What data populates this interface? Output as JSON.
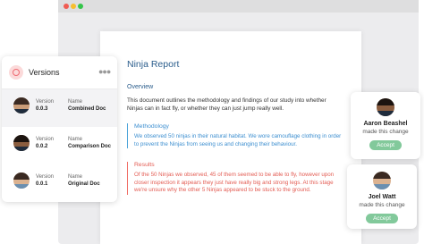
{
  "document": {
    "title": "Ninja Report",
    "overview": {
      "heading": "Overview",
      "text": "This document outlines the methodology and findings of our study into whether Ninjas can in fact fly, or whether they can just jump really well."
    },
    "methodology": {
      "heading": "Methodology",
      "text": "We observed 50 ninjas in their natural habitat. We wore camouflage clothing in order to prevent the Ninjas from seeing us and changing their behaviour."
    },
    "results": {
      "heading": "Results",
      "text": "Of the 50 Ninjas we observed, 45 of them seemed to be able to fly, however upon closer inspection it appears they just have really big and strong legs. At this stage we're unsure why the other 5 Ninjas appeared to be stuck to the ground."
    }
  },
  "versions_panel": {
    "title": "Versions",
    "more_icon": "more-horizontal-icon",
    "version_label": "Version",
    "name_label": "Name",
    "items": [
      {
        "version": "0.0.3",
        "name": "Combined Doc"
      },
      {
        "version": "0.0.2",
        "name": "Comparison Doc"
      },
      {
        "version": "0.0.1",
        "name": "Original Doc"
      }
    ]
  },
  "reviewers": [
    {
      "name": "Aaron Beashel",
      "action": "made this change",
      "button": "Accept"
    },
    {
      "name": "Joel Watt",
      "action": "made this change",
      "button": "Accept"
    }
  ],
  "colors": {
    "accent_blue": "#3d8fd0",
    "accent_red": "#e35c53",
    "accept_green": "#82c99b",
    "title_blue": "#2b5d8c"
  }
}
